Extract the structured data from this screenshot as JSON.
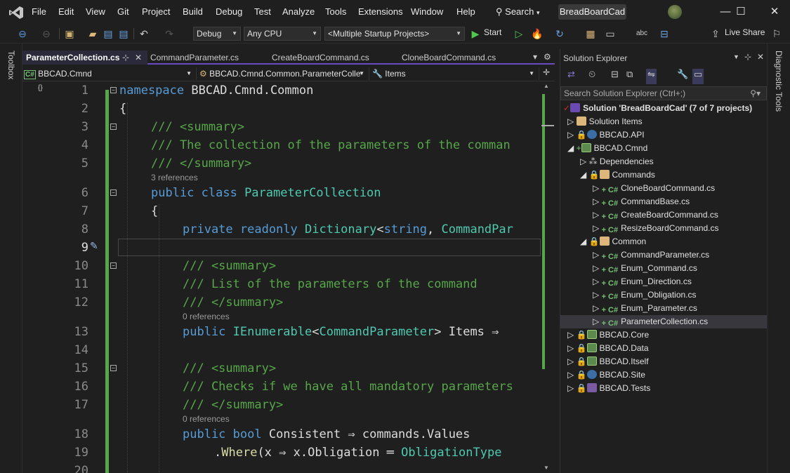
{
  "app": {
    "name": "BreadBoardCad"
  },
  "menu": [
    "File",
    "Edit",
    "View",
    "Git",
    "Project",
    "Build",
    "Debug",
    "Test",
    "Analyze",
    "Tools",
    "Extensions",
    "Window",
    "Help"
  ],
  "search_label": "Search",
  "window": {
    "minimize": "—",
    "maximize": "☐",
    "close": "✕"
  },
  "toolbar": {
    "config": "Debug",
    "platform": "Any CPU",
    "startup": "<Multiple Startup Projects>",
    "start_label": "Start",
    "live_share": "Live Share"
  },
  "left_panel": {
    "toolbox": "Toolbox"
  },
  "right_panel": {
    "diagnostic": "Diagnostic Tools"
  },
  "editor": {
    "tabs": [
      {
        "label": "ParameterCollection.cs",
        "active": true
      },
      {
        "label": "CommandParameter.cs"
      },
      {
        "label": "CreateBoardCommand.cs"
      },
      {
        "label": "CloneBoardCommand.cs"
      }
    ],
    "nav": {
      "project": "BBCAD.Cmnd",
      "type": "BBCAD.Cmnd.Common.ParameterColle",
      "member": "Items"
    },
    "line_numbers": [
      "1",
      "2",
      "3",
      "4",
      "5",
      "6",
      "7",
      "8",
      "9",
      "10",
      "11",
      "12",
      "13",
      "14",
      "15",
      "16",
      "17",
      "18",
      "19",
      "20"
    ],
    "code": {
      "l1_kw": "namespace",
      "l1_id": " BBCAD.Cmnd.Common",
      "l2": "{",
      "l3": "/// <summary>",
      "l4": "/// The collection of the parameters of the comman",
      "l5": "/// </summary>",
      "ref6": "3 references",
      "l6_kw": "public class",
      "l6_ty": " ParameterCollection",
      "l7": "{",
      "l8_kw": "private readonly",
      "l8_ty": " Dictionary",
      "l8_a": "<",
      "l8_kw2": "string",
      "l8_b": ", ",
      "l8_ty2": "CommandPar",
      "l10": "/// <summary>",
      "l11": "/// List of the parameters of the command",
      "l12": "/// </summary>",
      "ref13": "0 references",
      "l13_kw": "public",
      "l13_ty": " IEnumerable",
      "l13_a": "<",
      "l13_ty2": "CommandParameter",
      "l13_b": "> Items ⇒",
      "l15": "/// <summary>",
      "l16": "/// Checks if we have all mandatory parameters",
      "l17": "/// </summary>",
      "ref18": "0 references",
      "l18_kw": "public bool",
      "l18_id": " Consistent ⇒ commands.Values",
      "l19_a": ".",
      "l19_mt": "Where",
      "l19_b": "(x ⇒ x.Obligation ═ ",
      "l19_ty": "ObligationType"
    }
  },
  "solution_explorer": {
    "title": "Solution Explorer",
    "search_placeholder": "Search Solution Explorer (Ctrl+;)",
    "solution": "Solution 'BreadBoardCad' (7 of 7 projects)",
    "items": [
      "Solution Items",
      "BBCAD.API",
      "BBCAD.Cmnd",
      "Dependencies",
      "Commands",
      "CloneBoardCommand.cs",
      "CommandBase.cs",
      "CreateBoardCommand.cs",
      "ResizeBoardCommand.cs",
      "Common",
      "CommandParameter.cs",
      "Enum_Command.cs",
      "Enum_Direction.cs",
      "Enum_Obligation.cs",
      "Enum_Parameter.cs",
      "ParameterCollection.cs",
      "BBCAD.Core",
      "BBCAD.Data",
      "BBCAD.Itself",
      "BBCAD.Site",
      "BBCAD.Tests"
    ]
  },
  "colors": {
    "accent": "#6a4ac0",
    "green_bar": "#57a64a",
    "keyword": "#569cd6",
    "type": "#4ec9b0",
    "comment": "#57a64a"
  }
}
